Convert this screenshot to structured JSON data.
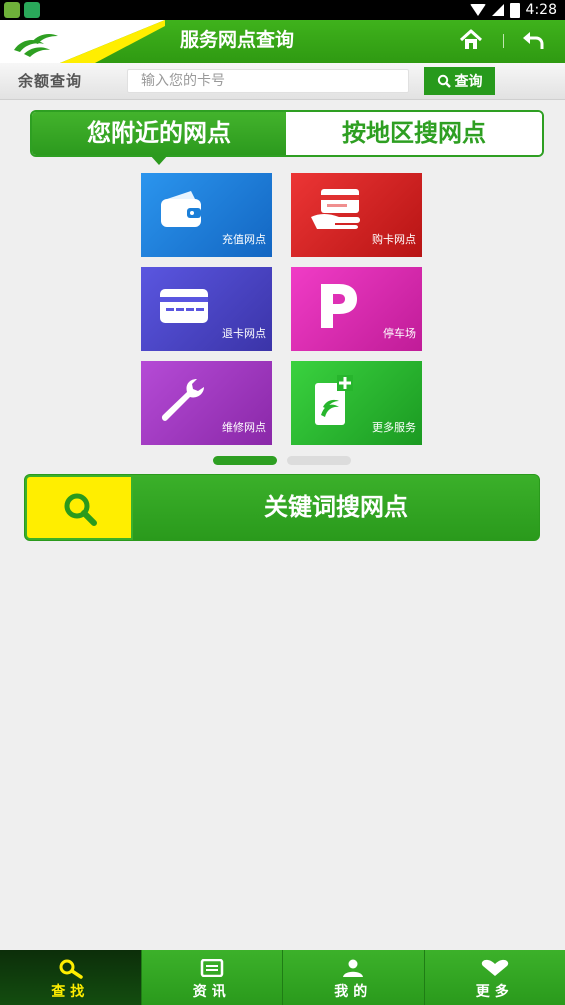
{
  "status_bar": {
    "time": "4:28"
  },
  "header": {
    "title": "服务网点查询"
  },
  "balance": {
    "label": "余额查询",
    "input_placeholder": "输入您的卡号",
    "input_value": "",
    "query_button": "查询"
  },
  "tabs": [
    {
      "label": "您附近的网点",
      "active": true
    },
    {
      "label": "按地区搜网点",
      "active": false
    }
  ],
  "tiles": [
    {
      "label": "充值网点",
      "color": "#1b7fd8",
      "icon": "wallet-icon"
    },
    {
      "label": "购卡网点",
      "color": "#d11f1f",
      "icon": "card-in-hand-icon"
    },
    {
      "label": "退卡网点",
      "color": "#4b45c8",
      "icon": "card-icon"
    },
    {
      "label": "停车场",
      "color": "#e027b6",
      "icon": "parking-icon"
    },
    {
      "label": "维修网点",
      "color": "#a237c3",
      "icon": "wrench-icon"
    },
    {
      "label": "更多服务",
      "color": "#27b52d",
      "icon": "more-services-icon"
    }
  ],
  "pager": {
    "pages": 2,
    "current": 1
  },
  "keyword_search": {
    "label": "关键词搜网点"
  },
  "bottom_nav": [
    {
      "label": "查找",
      "icon": "search-icon",
      "active": true
    },
    {
      "label": "资讯",
      "icon": "news-icon",
      "active": false
    },
    {
      "label": "我的",
      "icon": "user-icon",
      "active": false
    },
    {
      "label": "更多",
      "icon": "heart-icon",
      "active": false
    }
  ]
}
